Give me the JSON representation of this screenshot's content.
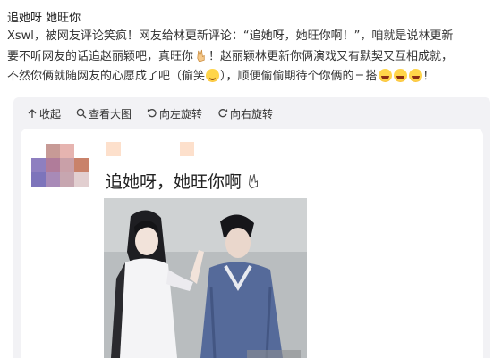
{
  "title": "追她呀 她旺你",
  "paragraph": {
    "line1": "Xswl，被网友评论笑疯！网友给林更新评论：“追她呀，她旺你啊！”，咱就是说林更新",
    "line2_a": "要不听网友的话追赵丽颖吧，真旺你",
    "line2_b": "！赵丽颖林更新你俩演戏又有默契又互相成就，",
    "line3_a": "不然你俩就随网友的心愿成了吧（偷笑",
    "line3_b": "），顺便偷偷期待个你俩的三搭",
    "line3_c": "！"
  },
  "toolbar": {
    "collapse": "收起",
    "view_large": "查看大图",
    "rotate_left": "向左旋转",
    "rotate_right": "向右旋转"
  },
  "post": {
    "text": "追她呀，她旺你啊"
  },
  "icons": [
    "collapse-icon",
    "zoom-icon",
    "rotate-left-icon",
    "rotate-right-icon",
    "victory-hand-icon",
    "laughing-emoji-icon",
    "smile-emoji-icon"
  ]
}
